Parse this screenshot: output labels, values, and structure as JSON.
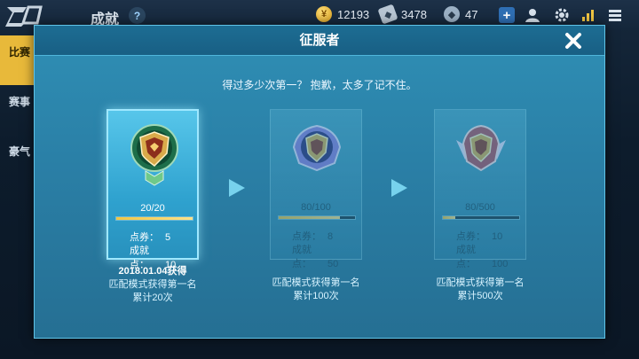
{
  "header": {
    "page_title": "成就",
    "help_label": "?",
    "resources": [
      {
        "icon": "coin-icon",
        "value": "12193"
      },
      {
        "icon": "ticket-icon",
        "value": "3478"
      },
      {
        "icon": "diamond-icon",
        "value": "47"
      }
    ]
  },
  "left_tabs": [
    {
      "label": "比赛",
      "active": true
    },
    {
      "label": "赛事",
      "active": false
    },
    {
      "label": "豪气",
      "active": false
    }
  ],
  "modal": {
    "title": "征服者",
    "subtitle": "得过多少次第一？ 抱歉，太多了记不住。",
    "tiers": [
      {
        "progress": "20/20",
        "progress_fraction": 1.0,
        "voucher_label": "点券：",
        "voucher_value": "5",
        "points_label": "成就点：",
        "points_value": "10",
        "achieved_date": "2018.01.04获得",
        "desc_line1": "匹配模式获得第一名",
        "desc_line2": "累计20次",
        "state": "achieved",
        "badge_color": "#c9a04a"
      },
      {
        "progress": "80/100",
        "progress_fraction": 0.8,
        "voucher_label": "点券：",
        "voucher_value": "8",
        "points_label": "成就点：",
        "points_value": "50",
        "desc_line1": "匹配模式获得第一名",
        "desc_line2": "累计100次",
        "state": "locked",
        "badge_color": "#7b6ad1"
      },
      {
        "progress": "80/500",
        "progress_fraction": 0.16,
        "voucher_label": "点券：",
        "voucher_value": "10",
        "points_label": "成就点：",
        "points_value": "100",
        "desc_line1": "匹配模式获得第一名",
        "desc_line2": "累计500次",
        "state": "locked",
        "badge_color": "#b04a5a"
      }
    ]
  },
  "colors": {
    "accent_gold": "#f1c542",
    "modal_bg": "#2a7fa6",
    "arrow": "#7fdcf5"
  }
}
